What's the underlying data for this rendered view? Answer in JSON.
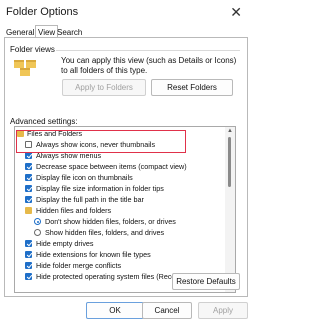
{
  "window": {
    "title": "Folder Options",
    "close_glyph": "✕"
  },
  "tabs": [
    {
      "label": "General"
    },
    {
      "label": "View"
    },
    {
      "label": "Search"
    }
  ],
  "folder_views": {
    "title": "Folder views",
    "description": "You can apply this view (such as Details or Icons) to all folders of this type.",
    "apply_button": "Apply to Folders",
    "reset_button": "Reset Folders"
  },
  "advanced": {
    "label": "Advanced settings:",
    "items": [
      {
        "kind": "folder",
        "label": "Files and Folders"
      },
      {
        "kind": "checkbox",
        "checked": false,
        "label": "Always show icons, never thumbnails"
      },
      {
        "kind": "checkbox",
        "checked": true,
        "label": "Always show menus"
      },
      {
        "kind": "checkbox",
        "checked": true,
        "label": "Decrease space between items (compact view)"
      },
      {
        "kind": "checkbox",
        "checked": true,
        "label": "Display file icon on thumbnails"
      },
      {
        "kind": "checkbox",
        "checked": true,
        "label": "Display file size information in folder tips"
      },
      {
        "kind": "checkbox",
        "checked": true,
        "label": "Display the full path in the title bar"
      },
      {
        "kind": "folder",
        "label": "Hidden files and folders"
      },
      {
        "kind": "radio",
        "checked": true,
        "label": "Don't show hidden files, folders, or drives"
      },
      {
        "kind": "radio",
        "checked": false,
        "label": "Show hidden files, folders, and drives"
      },
      {
        "kind": "checkbox",
        "checked": true,
        "label": "Hide empty drives"
      },
      {
        "kind": "checkbox",
        "checked": true,
        "label": "Hide extensions for known file types"
      },
      {
        "kind": "checkbox",
        "checked": true,
        "label": "Hide folder merge conflicts"
      },
      {
        "kind": "checkbox",
        "checked": true,
        "label": "Hide protected operating system files (Recommended)"
      }
    ],
    "restore_button": "Restore Defaults"
  },
  "footer": {
    "ok": "OK",
    "cancel": "Cancel",
    "apply": "Apply"
  },
  "colors": {
    "accent": "#1f6fc8",
    "highlight": "#e0314a",
    "folder": "#e6b94a"
  }
}
